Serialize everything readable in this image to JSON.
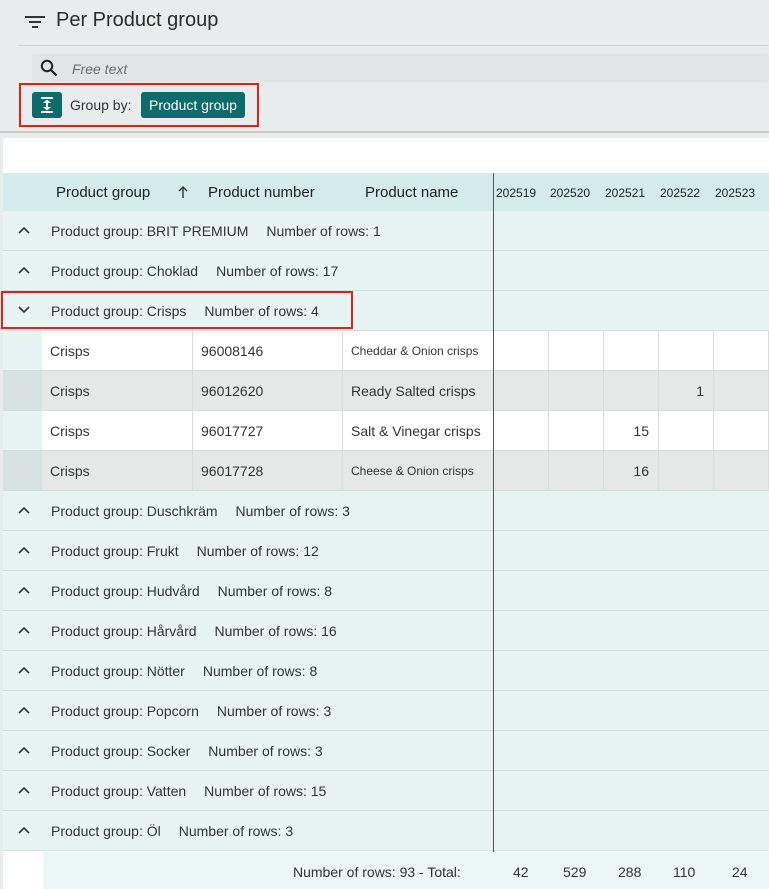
{
  "header": {
    "title": "Per Product group",
    "search_placeholder": "Free text",
    "group_by_label": "Group by:",
    "group_by_chip": "Product group"
  },
  "columns": {
    "product_group": "Product group",
    "product_number": "Product number",
    "product_name": "Product name",
    "weeks": [
      "202519",
      "202520",
      "202521",
      "202522",
      "202523"
    ]
  },
  "groups": [
    {
      "label": "Product group: BRIT PREMIUM",
      "count": "Number of rows: 1"
    },
    {
      "label": "Product group: Choklad",
      "count": "Number of rows: 17"
    },
    {
      "label": "Product group: Crisps",
      "count": "Number of rows: 4"
    },
    {
      "label": "Product group: Duschkräm",
      "count": "Number of rows: 3"
    },
    {
      "label": "Product group: Frukt",
      "count": "Number of rows: 12"
    },
    {
      "label": "Product group: Hudvård",
      "count": "Number of rows: 8"
    },
    {
      "label": "Product group: Hårvård",
      "count": "Number of rows: 16"
    },
    {
      "label": "Product group: Nötter",
      "count": "Number of rows: 8"
    },
    {
      "label": "Product group: Popcorn",
      "count": "Number of rows: 3"
    },
    {
      "label": "Product group: Socker",
      "count": "Number of rows: 3"
    },
    {
      "label": "Product group: Vatten",
      "count": "Number of rows: 15"
    },
    {
      "label": "Product group: Öl",
      "count": "Number of rows: 3"
    }
  ],
  "crisps_rows": [
    {
      "group": "Crisps",
      "number": "96008146",
      "name": "Cheddar & Onion crisps",
      "weeks": [
        "",
        "",
        "",
        "",
        ""
      ]
    },
    {
      "group": "Crisps",
      "number": "96012620",
      "name": "Ready Salted crisps",
      "weeks": [
        "",
        "",
        "",
        "1",
        ""
      ]
    },
    {
      "group": "Crisps",
      "number": "96017727",
      "name": "Salt & Vinegar crisps",
      "weeks": [
        "",
        "",
        "15",
        "",
        ""
      ]
    },
    {
      "group": "Crisps",
      "number": "96017728",
      "name": "Cheese & Onion crisps",
      "weeks": [
        "",
        "",
        "16",
        "",
        ""
      ]
    }
  ],
  "footer": {
    "summary": "Number of rows: 93  -  Total:",
    "totals": [
      "42",
      "529",
      "288",
      "110",
      "24"
    ]
  },
  "colors": {
    "accent": "#0e6b6b",
    "highlight": "#d9231f",
    "group_row_bg": "#e8f3f3",
    "header_bg": "#d3ebeb"
  }
}
